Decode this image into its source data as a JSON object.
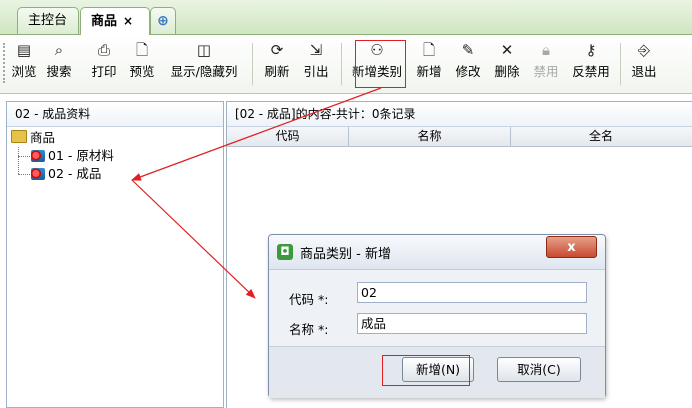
{
  "tabs": {
    "console": "主控台",
    "products": "商品",
    "close_glyph": "×",
    "add_glyph": "⊕"
  },
  "toolbar": {
    "browse": "浏览",
    "search": "搜索",
    "print": "打印",
    "preview": "预览",
    "show_hide_cols": "显示/隐藏列",
    "refresh": "刷新",
    "export": "引出",
    "new_category": "新增类别",
    "new": "新增",
    "edit": "修改",
    "delete": "删除",
    "disable": "禁用",
    "enable": "反禁用",
    "exit": "退出"
  },
  "tree": {
    "header": "02 - 成品资料",
    "root": "商品",
    "items": [
      {
        "label": "01 - 原材料"
      },
      {
        "label": "02 - 成品"
      }
    ]
  },
  "list": {
    "header": "[02 - 成品]的内容-共计：0条记录",
    "columns": [
      "代码",
      "名称",
      "全名"
    ]
  },
  "dialog": {
    "title": "商品类别 - 新增",
    "close_label": "x",
    "code_label": "代码 *:",
    "code_value": "02",
    "name_label": "名称 *:",
    "name_value": "成品",
    "ok_label": "新增(N)",
    "cancel_label": "取消(C)"
  },
  "colors": {
    "highlight": "#e02020",
    "tab_green": "#cfe6c2"
  }
}
